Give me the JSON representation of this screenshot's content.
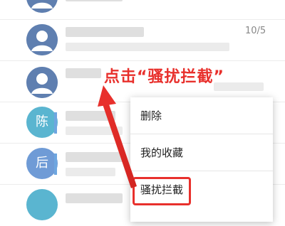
{
  "annotation": {
    "callout_text": "点击“骚扰拦截”",
    "color": "#e8302c"
  },
  "contacts": [
    {
      "avatar": "person-icon",
      "time": ""
    },
    {
      "avatar": "person-icon",
      "time": "10/5"
    },
    {
      "avatar": "person-icon",
      "time": ""
    },
    {
      "avatar": "initial",
      "initial": "陈",
      "color": "#5ab5d0",
      "time": ""
    },
    {
      "avatar": "initial",
      "initial": "后",
      "color": "#6f9bd6",
      "time": ""
    },
    {
      "avatar": "initial",
      "initial": "",
      "color": "#5ab5d0",
      "time": ""
    }
  ],
  "context_menu": {
    "items": [
      "删除",
      "我的收藏",
      "骚扰拦截"
    ]
  },
  "colors": {
    "accent_red": "#e8302c",
    "avatar_blue": "#5f7fb0"
  }
}
